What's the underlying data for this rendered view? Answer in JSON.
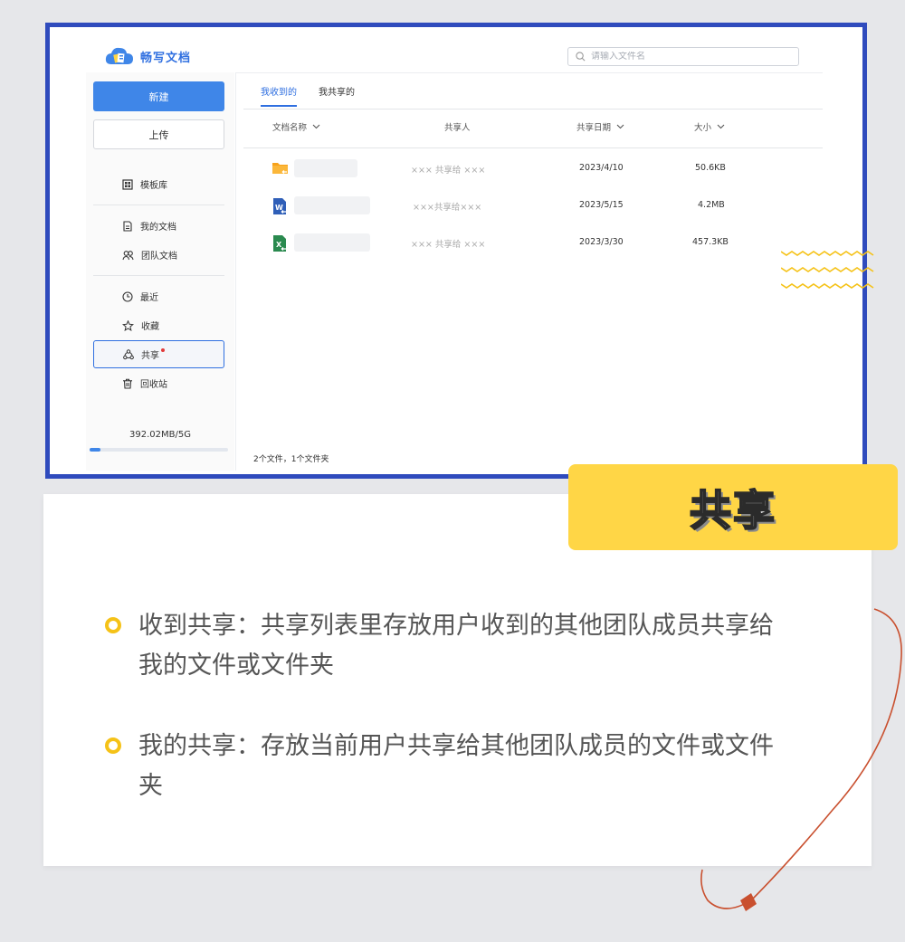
{
  "app": {
    "logo_text": "畅写文档",
    "search_placeholder": "请输入文件名"
  },
  "sidebar": {
    "new_label": "新建",
    "upload_label": "上传",
    "items": [
      {
        "label": "模板库",
        "icon": "template-icon"
      },
      {
        "label": "我的文档",
        "icon": "document-icon"
      },
      {
        "label": "团队文档",
        "icon": "team-icon"
      },
      {
        "label": "最近",
        "icon": "clock-icon"
      },
      {
        "label": "收藏",
        "icon": "star-icon"
      },
      {
        "label": "共享",
        "icon": "share-icon",
        "active": true,
        "notification_dot": true
      },
      {
        "label": "回收站",
        "icon": "trash-icon"
      }
    ],
    "storage_text": "392.02MB/5G",
    "storage_fraction": 0.08
  },
  "tabs": [
    {
      "label": "我收到的",
      "active": true
    },
    {
      "label": "我共享的",
      "active": false
    }
  ],
  "table": {
    "columns": [
      "文档名称",
      "共享人",
      "共享日期",
      "大小"
    ],
    "rows": [
      {
        "type": "folder",
        "icon": "folder-icon",
        "sharer": "××× 共享给 ×××",
        "date": "2023/4/10",
        "size": "50.6KB"
      },
      {
        "type": "word",
        "icon": "word-doc-icon",
        "sharer": "×××共享给×××",
        "date": "2023/5/15",
        "size": "4.2MB"
      },
      {
        "type": "excel",
        "icon": "excel-doc-icon",
        "sharer": "××× 共享给 ×××",
        "date": "2023/3/30",
        "size": "457.3KB"
      }
    ],
    "footer": "2个文件，1个文件夹"
  },
  "card": {
    "badge": "共享",
    "bullets": [
      "收到共享：共享列表里存放用户收到的其他团队成员共享给我的文件或文件夹",
      "我的共享：存放当前用户共享给其他团队成员的文件或文件夹"
    ]
  },
  "colors": {
    "frame_border": "#2f4bbd",
    "primary_blue": "#3f86e8",
    "badge_yellow": "#ffd646",
    "bullet_yellow": "#f5c218",
    "swoosh": "#c9502f"
  }
}
